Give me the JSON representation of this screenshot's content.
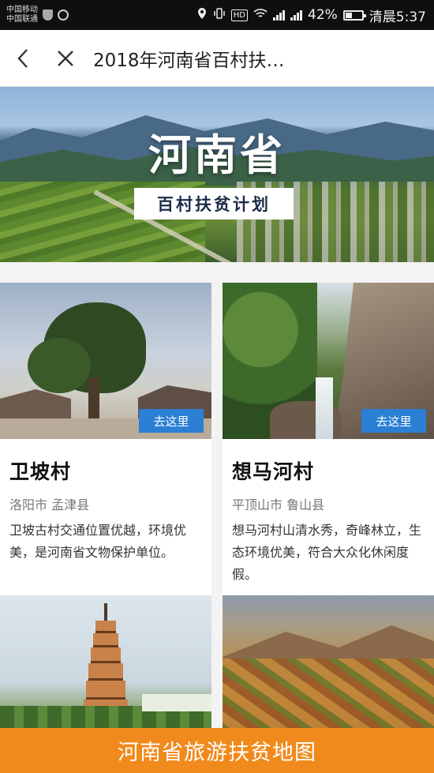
{
  "status_bar": {
    "carrier_1": "中国移动",
    "carrier_2": "中国联通",
    "battery": "42%",
    "time": "清晨5:37",
    "network_label": "HD",
    "battery_level": 0.42
  },
  "nav": {
    "title": "2018年河南省百村扶…"
  },
  "hero": {
    "title": "河南省",
    "subtitle": "百村扶贫计划"
  },
  "cards": [
    {
      "name": "卫坡村",
      "location": "洛阳市 孟津县",
      "description": "卫坡古村交通位置优越，环境优美，是河南省文物保护单位。",
      "button": "去这里"
    },
    {
      "name": "想马河村",
      "location": "平顶山市 鲁山县",
      "description": "想马河村山清水秀，奇峰林立，生态环境优美，符合大众化休闲度假。",
      "button": "去这里"
    },
    {},
    {}
  ],
  "bottom_bar": {
    "label": "河南省旅游扶贫地图"
  },
  "colors": {
    "accent_button": "#2b7fd4",
    "bottom_bar": "#f08a1c"
  }
}
